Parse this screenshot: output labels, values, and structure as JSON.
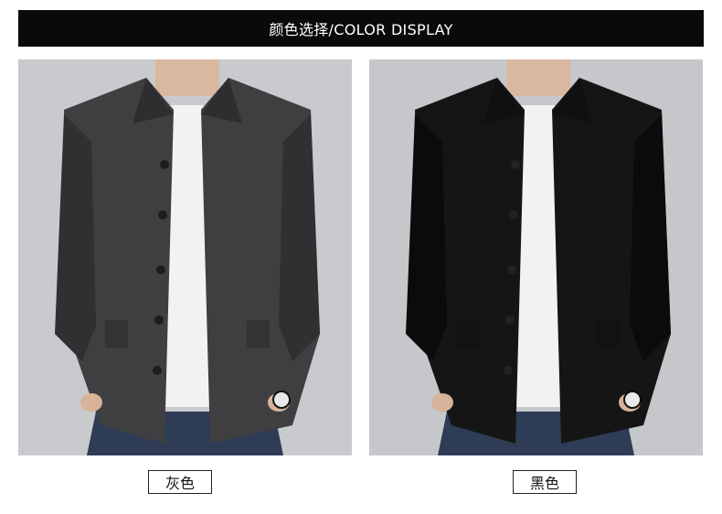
{
  "header": {
    "title": "颜色选择/COLOR DISPLAY"
  },
  "products": [
    {
      "label": "灰色",
      "jacket_color": "#3f3f42",
      "jacket_shade": "#303033",
      "background": "#c9cacd"
    },
    {
      "label": "黑色",
      "jacket_color": "#151515",
      "jacket_shade": "#0b0b0b",
      "background": "#c6c7ca"
    }
  ]
}
